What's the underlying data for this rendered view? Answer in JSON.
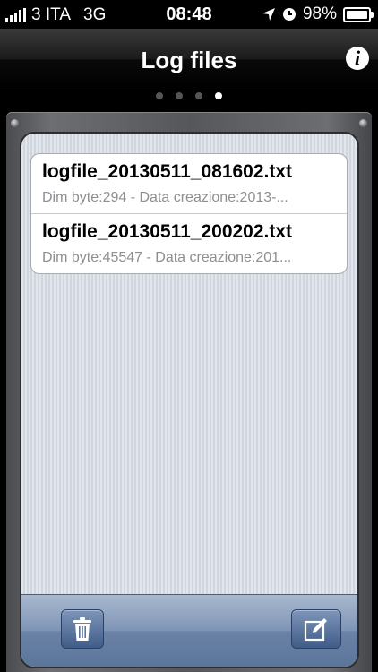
{
  "status_bar": {
    "carrier": "3 ITA",
    "network": "3G",
    "time": "08:48",
    "battery": "98%",
    "battery_level": 0.98
  },
  "nav": {
    "title": "Log files",
    "info_label": "i"
  },
  "pages": {
    "count": 4,
    "active": 4
  },
  "files": [
    {
      "name": "logfile_20130511_081602.txt",
      "detail": "Dim byte:294 - Data creazione:2013-..."
    },
    {
      "name": "logfile_20130511_200202.txt",
      "detail": "Dim byte:45547 - Data creazione:201..."
    }
  ],
  "toolbar": {
    "left_icon": "trash-icon",
    "right_icon": "compose-icon"
  }
}
